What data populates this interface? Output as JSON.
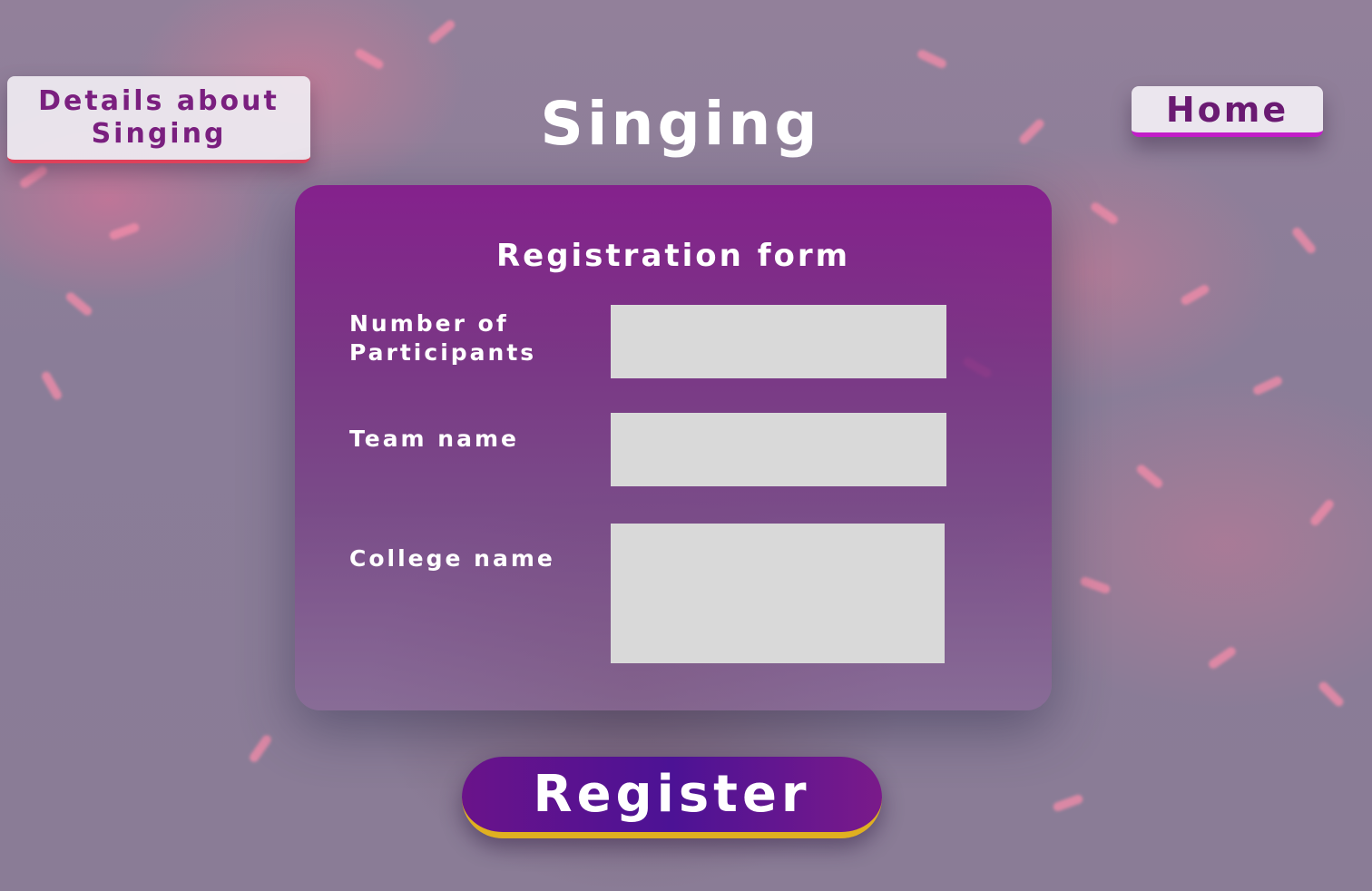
{
  "header": {
    "details_card_label": "Details about Singing",
    "page_title": "Singing",
    "home_label": "Home"
  },
  "form": {
    "title": "Registration form",
    "fields": [
      {
        "label": "Number of Participants",
        "value": "",
        "placeholder": ""
      },
      {
        "label": "Team name",
        "value": "",
        "placeholder": ""
      },
      {
        "label": "College name",
        "value": "",
        "placeholder": ""
      }
    ],
    "submit_label": "Register"
  },
  "colors": {
    "accent_purple": "#7a1f7f",
    "card_purple": "#841e8c",
    "register_gradient_mid": "#4c1295",
    "register_underline": "#e0b020",
    "home_underline": "#c21ec8",
    "details_underline": "#e0405a",
    "input_fill": "#d9d9d9"
  }
}
